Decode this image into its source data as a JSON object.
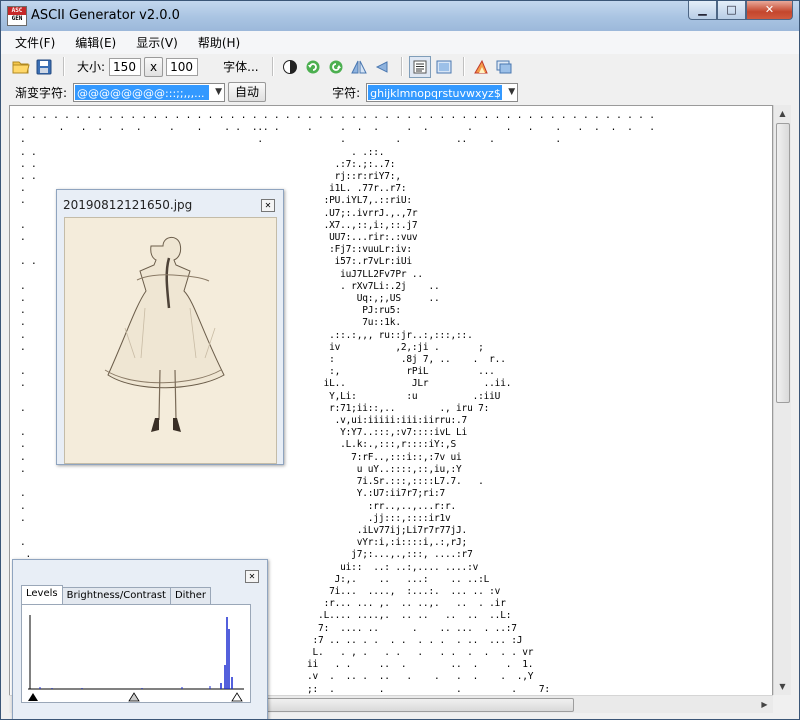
{
  "window": {
    "title": "ASCII Generator v2.0.0",
    "icon_text_top": "ASC",
    "icon_text_bottom": "GEN",
    "minimize_glyph": "▁",
    "maximize_glyph": "□",
    "close_glyph": "✕"
  },
  "menu": [
    "文件(F)",
    "编辑(E)",
    "显示(V)",
    "帮助(H)"
  ],
  "toolbar": {
    "size_label": "大小:",
    "width_value": "150",
    "times_label": "x",
    "height_value": "100",
    "font_button": "字体...",
    "icons": [
      "open-folder-icon",
      "save-icon",
      "invert-icon",
      "rotate-icon",
      "refresh-icon",
      "flip-horizontal-icon",
      "flip-vertical-icon",
      "text-view-icon",
      "image-view-icon",
      "color-icon",
      "export-icon"
    ]
  },
  "toolbar2": {
    "ramp_label": "渐变字符:",
    "ramp_value": "@@@@@@@@:::;;,,,...",
    "auto_button": "自动",
    "chars_label": "字符:",
    "chars_value": "ghijklmnopqrstuvwxyz$"
  },
  "preview": {
    "title": "20190812121650.jpg",
    "close_glyph": "✕"
  },
  "levels": {
    "tabs": [
      "Levels",
      "Brightness/Contrast",
      "Dither"
    ],
    "close_glyph": "✕"
  },
  "ascii_art": ". . . . . . . . . . . . . . . . . . . . . . . . . . . . . . . . . . . . . . . . . . . . . . . . . . . . . . . . . .\n.      .   .  .   .  .     .    .    . .  ... .     .     .  .  .     .  .       .      .   .    .   .  .  .  .   .\n.                                          .              .         .          ..    .           .\n. .                                                         . .::.\n. .                                                      .:7:.;:..7:\n. .                                                      rj::r:riY7:,\n.                                                       i1L. .77r..r7:\n.                                                      :PU.iYL7,.::riU:\n                                                       .U7;:.ivrrJ.,.,7r\n.                                                      .X7..,::,i:,::.j7\n.                                                       UU7:...rir:.:vuv\n                                                        :Fj7::vuuLr:iv:\n. .                                                      i57:.r7vLr:iUi\n                                                          iuJ7LL2Fv7Pr ..\n.                                                         . rXv7Li:.2j    ..\n.                                                            Uq:,;,US     ..\n.                                                             PJ:ru5:\n.                                                             7u::1k.\n.                                                       .::.:,,, ru::jr..:,:::,::.\n.                                                       iv          ,2,:ji .       ;\n                                                        :            .8j 7, ..    .  r..\n.                                                       :,            rPiL         ...\n.                                                      iL..            JLr          ..ii.\n                                                        Y,Li:         :u          .:iiU\n.                                                       r:71;ii::,..        ., iru 7:\n                                                         .v,ui:iiiii:iii:iirru:.7\n.                                                         Y:Y7..:::,:v7::::ivL Li\n.                                                         .L.k:.,:::,r::::iY:,S\n.                                                           7:rF..,:::i::,:7v ui\n.                                                            u uY..::::,::,iu,:Y\n                                                             7i.Sr.:::,::::L7.7.   .\n.                                                            Y.:U7:ii7r7;ri:7\n.                                                              :rr..,..,...r:r.\n.                                                              .jj:::,::::ir1v\n                                                             .iLv77ij;Li7r7r77jJ.\n.                                                            vYr:i,:i::::i,.:,rJ;\n .                                                          j7;:...,.,:::, ....:r7\n                                                          ui::  ..: ..:,.... ....:v\n                                                         J:,.    ..   ...:    .. ..:L\n                                                        7i...  ....,  :...:.  ... .. :v\n                                                       :r... ... ,.  .. ..,.   ..  . .ir\n                                                      .L.... ....,.  .. ..   ..  ..  ..L:\n                                                      7:  .... ..      .    .. ...  . ..:7\n                                                     :7 .. .. . .  . .  . . .  . ..  ... :J\n                                                     L.   . , .   . .   .   . .  .  .  . . vr\n                                                    ii   . .     ..  .        ..  .     .  1.\n                                                    .v  .  .. .  ..   .    .   .  .    .  .,Y\n                                                    ;:  .        .             .         .    7:\n                                                   .J .  .  . . .  .   .   . .  . .  . ..  .J"
}
